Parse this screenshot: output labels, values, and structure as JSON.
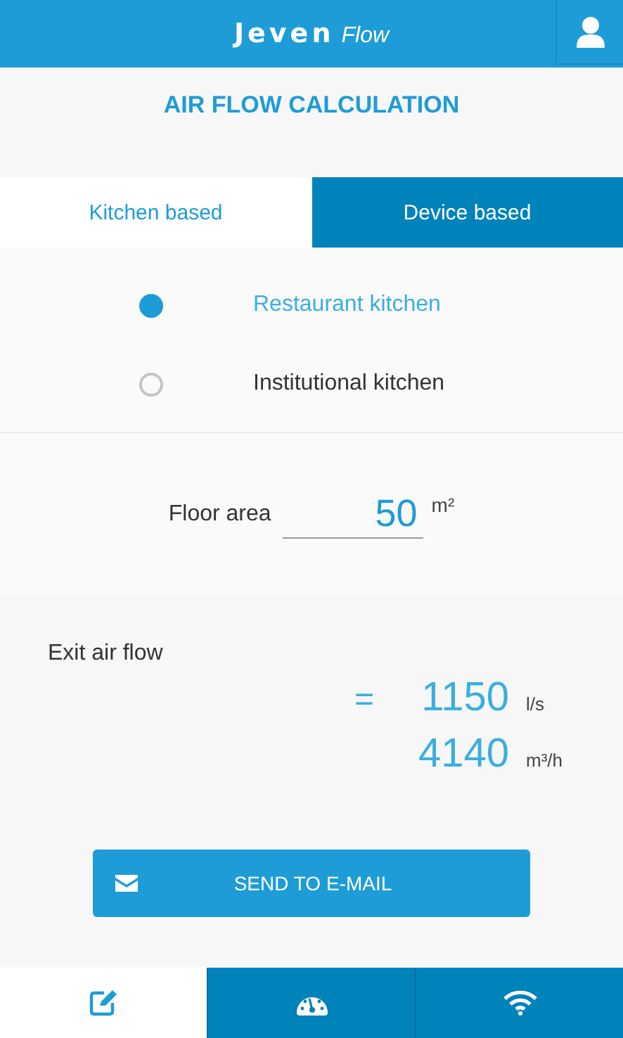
{
  "header": {
    "brand": "Jeven",
    "brand_suffix": "Flow"
  },
  "title": "AIR FLOW CALCULATION",
  "tabs": [
    {
      "label": "Kitchen based",
      "selected": true
    },
    {
      "label": "Device based",
      "selected": false
    }
  ],
  "kitchen_types": [
    {
      "label": "Restaurant kitchen",
      "selected": true
    },
    {
      "label": "Institutional kitchen",
      "selected": false
    }
  ],
  "floor_area": {
    "label": "Floor area",
    "value": "50",
    "unit": "m²"
  },
  "result": {
    "label": "Exit air flow",
    "equals": "=",
    "values": [
      {
        "value": "1150",
        "unit": "l/s"
      },
      {
        "value": "4140",
        "unit": "m³/h"
      }
    ]
  },
  "send_button": "SEND TO E-MAIL",
  "bottom_nav": [
    {
      "kind": "edit",
      "selected": true
    },
    {
      "kind": "gauge",
      "selected": false
    },
    {
      "kind": "wifi",
      "selected": false
    }
  ]
}
